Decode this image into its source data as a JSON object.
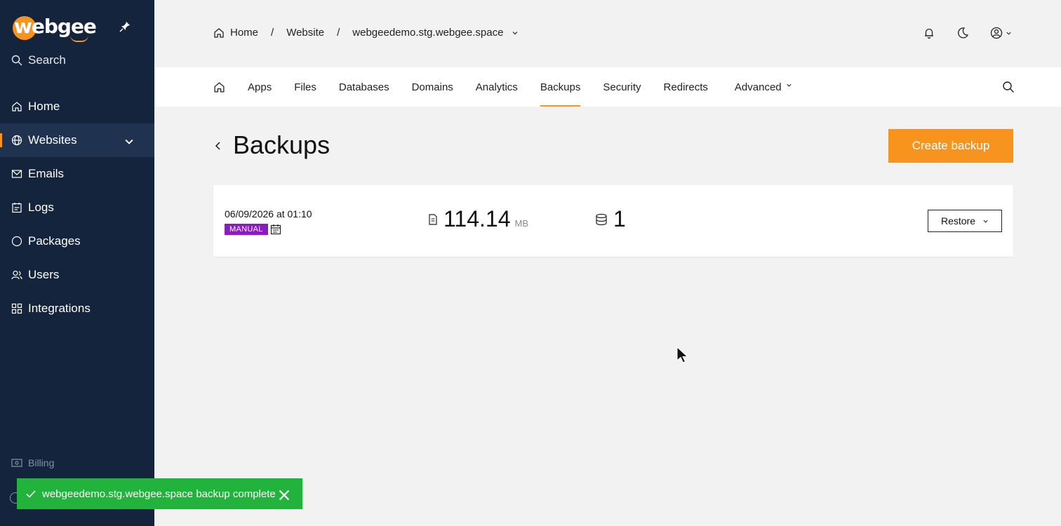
{
  "brand": {
    "name": "webgee",
    "accent": "#f7941d",
    "sidebar_bg": "#13243c"
  },
  "sidebar": {
    "search_label": "Search",
    "items": [
      {
        "label": "Home",
        "icon": "home-icon"
      },
      {
        "label": "Websites",
        "icon": "globe-icon",
        "active": true
      },
      {
        "label": "Emails",
        "icon": "mail-icon"
      },
      {
        "label": "Logs",
        "icon": "log-icon"
      },
      {
        "label": "Packages",
        "icon": "package-icon"
      },
      {
        "label": "Users",
        "icon": "users-icon"
      },
      {
        "label": "Integrations",
        "icon": "grid-icon"
      }
    ],
    "billing_label": "Billing"
  },
  "breadcrumb": {
    "home": "Home",
    "section": "Website",
    "site": "webgeedemo.stg.webgee.space"
  },
  "tabs": [
    "Apps",
    "Files",
    "Databases",
    "Domains",
    "Analytics",
    "Backups",
    "Security",
    "Redirects",
    "Advanced"
  ],
  "active_tab": "Backups",
  "page": {
    "title": "Backups",
    "create_button": "Create backup"
  },
  "backups": [
    {
      "date": "06/09/2026 at 01:10",
      "type": "MANUAL",
      "size": "114.14",
      "size_unit": "MB",
      "databases": "1",
      "action": "Restore"
    }
  ],
  "toast": {
    "message": "webgeedemo.stg.webgee.space backup complete",
    "color": "#22b33c"
  }
}
